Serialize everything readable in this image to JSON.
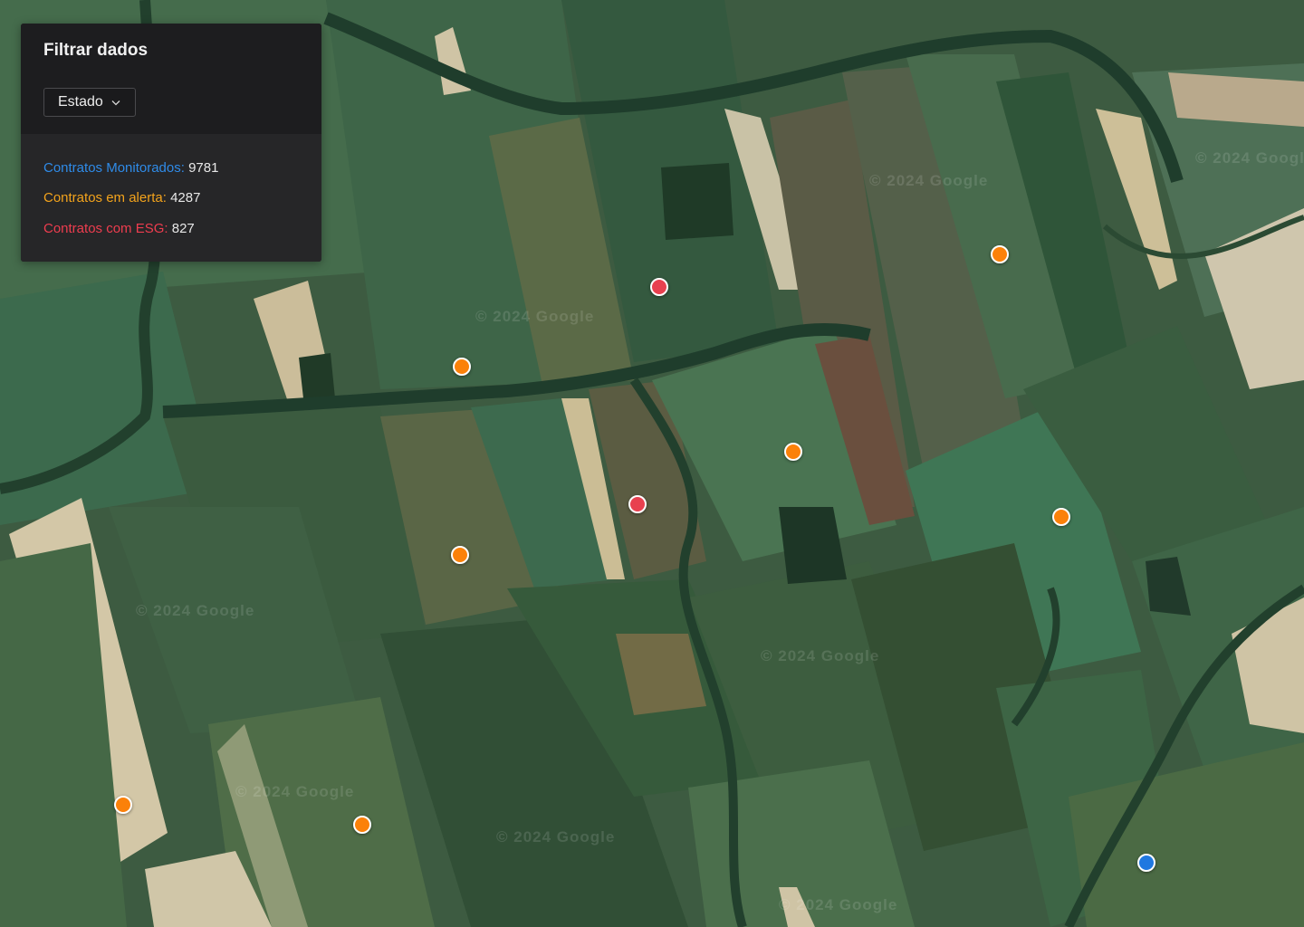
{
  "panel": {
    "title": "Filtrar dados",
    "filter": {
      "label": "Estado",
      "icon": "chevron-down-icon"
    },
    "stats": [
      {
        "label": "Contratos Monitorados:",
        "value": "9781",
        "color": "#2f8be8"
      },
      {
        "label": "Contratos em alerta:",
        "value": "4287",
        "color": "#f3a31c"
      },
      {
        "label": "Contratos com ESG:",
        "value": "827",
        "color": "#ee3d4f"
      }
    ]
  },
  "map": {
    "watermark": "© 2024 Google",
    "markers": [
      {
        "status": "esg",
        "color": "#e8404f"
      },
      {
        "status": "esg",
        "color": "#e8404f"
      },
      {
        "status": "alerta",
        "color": "#fb8109"
      },
      {
        "status": "alerta",
        "color": "#fb8109"
      },
      {
        "status": "alerta",
        "color": "#fb8109"
      },
      {
        "status": "alerta",
        "color": "#fb8109"
      },
      {
        "status": "alerta",
        "color": "#fb8109"
      },
      {
        "status": "alerta",
        "color": "#fb8109"
      },
      {
        "status": "alerta",
        "color": "#fb8109"
      },
      {
        "status": "monitorado",
        "color": "#1f78e0"
      }
    ]
  }
}
